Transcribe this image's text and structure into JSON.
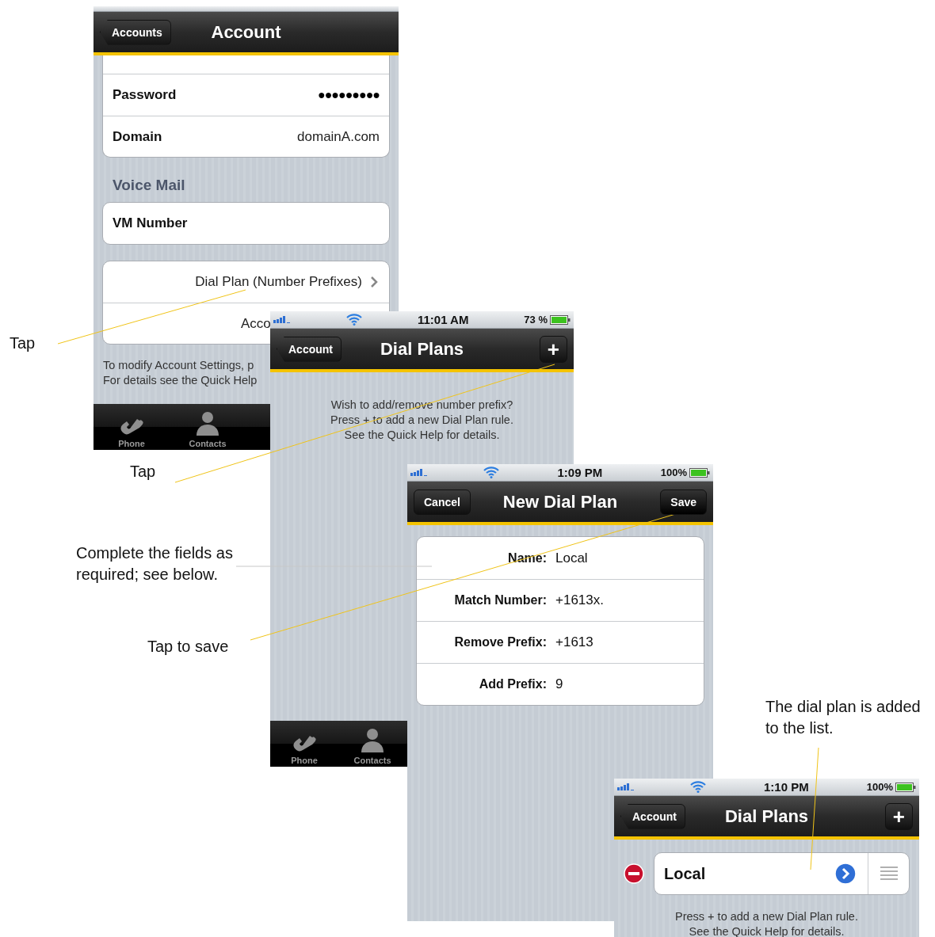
{
  "annotations": [
    {
      "text": "Tap"
    },
    {
      "text": "Tap"
    },
    {
      "text": "Complete the fields as required; see below."
    },
    {
      "text": "Tap to save"
    },
    {
      "text": "The dial plan is added to the list."
    }
  ],
  "account_screen": {
    "nav": {
      "back": "Accounts",
      "title": "Account"
    },
    "rows": [
      {
        "label": "Password",
        "value": "●●●●●●●●●"
      },
      {
        "label": "Domain",
        "value": "domainA.com"
      }
    ],
    "section_header": "Voice Mail",
    "vm_row": {
      "label": "VM Number"
    },
    "links": [
      "Dial Plan (Number Prefixes)",
      "Acco"
    ],
    "help": [
      "To modify Account Settings, p",
      "For details see the Quick Help"
    ],
    "tabs": [
      {
        "label": "Phone"
      },
      {
        "label": "Contacts"
      }
    ]
  },
  "dial_plans_screen": {
    "status": {
      "time": "11:01 AM",
      "battery": "73 %"
    },
    "nav": {
      "back": "Account",
      "title": "Dial Plans",
      "action": "+"
    },
    "message": [
      "Wish to add/remove number prefix?",
      "Press + to add a new Dial Plan rule.",
      "See the Quick Help for details."
    ],
    "tabs": [
      {
        "label": "Phone"
      },
      {
        "label": "Contacts"
      }
    ]
  },
  "new_dial_plan_screen": {
    "status": {
      "time": "1:09 PM",
      "battery": "100%"
    },
    "nav": {
      "cancel": "Cancel",
      "title": "New Dial Plan",
      "save": "Save"
    },
    "fields": [
      {
        "label": "Name:",
        "value": "Local"
      },
      {
        "label": "Match Number:",
        "value": "+1613x."
      },
      {
        "label": "Remove Prefix:",
        "value": "+1613"
      },
      {
        "label": "Add Prefix:",
        "value": "9"
      }
    ]
  },
  "dial_plans_list_screen": {
    "status": {
      "time": "1:10 PM",
      "battery": "100%"
    },
    "nav": {
      "back": "Account",
      "title": "Dial Plans",
      "action": "+"
    },
    "items": [
      {
        "name": "Local"
      }
    ],
    "message": [
      "Press + to add a new Dial Plan rule.",
      "See the Quick Help for details."
    ]
  }
}
